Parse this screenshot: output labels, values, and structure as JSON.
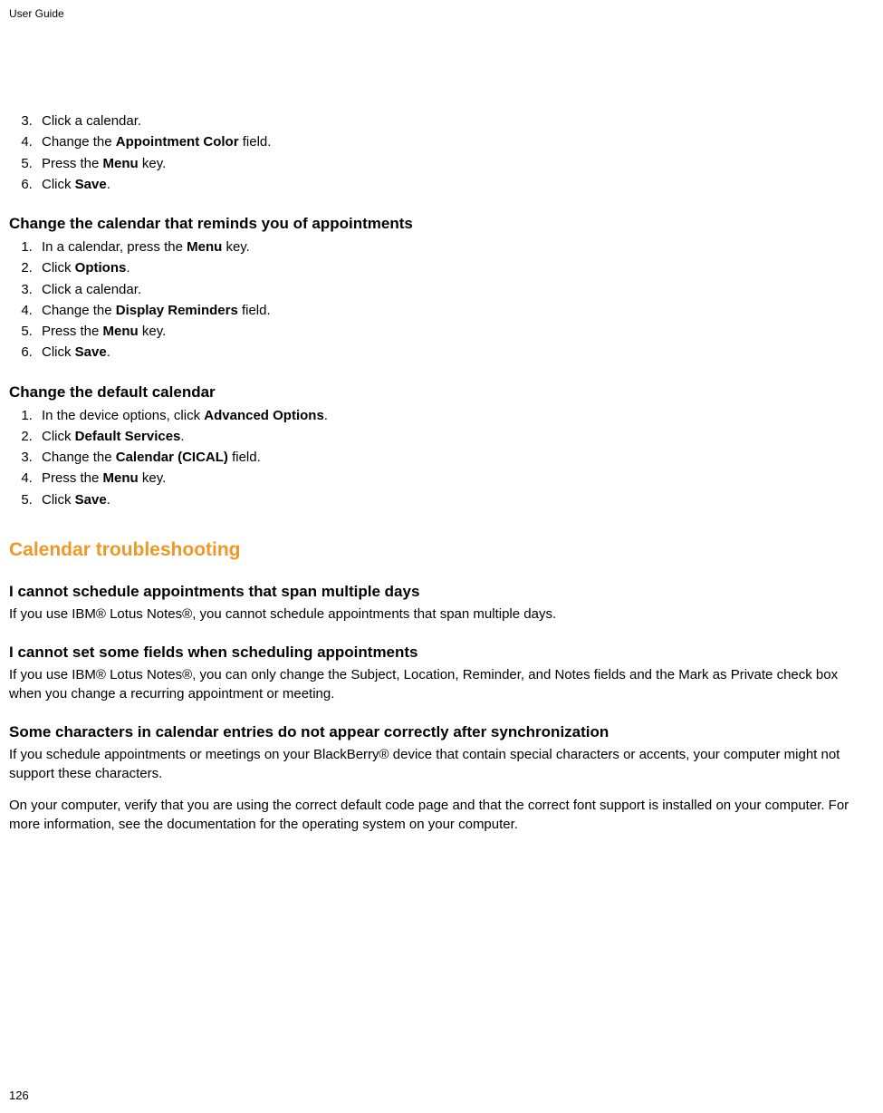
{
  "header": {
    "title": "User Guide"
  },
  "page_number": "126",
  "sectionA": {
    "start": 3,
    "items": [
      [
        {
          "t": "Click a calendar."
        }
      ],
      [
        {
          "t": "Change the "
        },
        {
          "b": "Appointment Color"
        },
        {
          "t": " field."
        }
      ],
      [
        {
          "t": "Press the "
        },
        {
          "b": "Menu"
        },
        {
          "t": " key."
        }
      ],
      [
        {
          "t": "Click "
        },
        {
          "b": "Save"
        },
        {
          "t": "."
        }
      ]
    ]
  },
  "sectionB": {
    "heading": "Change the calendar that reminds you of appointments",
    "start": 1,
    "items": [
      [
        {
          "t": "In a calendar, press the "
        },
        {
          "b": "Menu"
        },
        {
          "t": " key."
        }
      ],
      [
        {
          "t": "Click "
        },
        {
          "b": "Options"
        },
        {
          "t": "."
        }
      ],
      [
        {
          "t": "Click a calendar."
        }
      ],
      [
        {
          "t": "Change the "
        },
        {
          "b": "Display Reminders"
        },
        {
          "t": " field."
        }
      ],
      [
        {
          "t": "Press the "
        },
        {
          "b": "Menu"
        },
        {
          "t": " key."
        }
      ],
      [
        {
          "t": "Click "
        },
        {
          "b": "Save"
        },
        {
          "t": "."
        }
      ]
    ]
  },
  "sectionC": {
    "heading": "Change the default calendar",
    "start": 1,
    "items": [
      [
        {
          "t": "In the device options, click "
        },
        {
          "b": "Advanced Options"
        },
        {
          "t": "."
        }
      ],
      [
        {
          "t": "Click "
        },
        {
          "b": "Default Services"
        },
        {
          "t": "."
        }
      ],
      [
        {
          "t": "Change the "
        },
        {
          "b": "Calendar (CICAL)"
        },
        {
          "t": " field."
        }
      ],
      [
        {
          "t": "Press the "
        },
        {
          "b": "Menu"
        },
        {
          "t": " key."
        }
      ],
      [
        {
          "t": "Click "
        },
        {
          "b": "Save"
        },
        {
          "t": "."
        }
      ]
    ]
  },
  "troubleshooting": {
    "heading": "Calendar troubleshooting",
    "sub1": {
      "heading": "I cannot schedule appointments that span multiple days",
      "para1": "If you use IBM® Lotus Notes®, you cannot schedule appointments that span multiple days."
    },
    "sub2": {
      "heading": "I cannot set some fields when scheduling appointments",
      "para1": "If you use IBM® Lotus Notes®, you can only change the Subject, Location, Reminder, and Notes fields and the Mark as Private check box when you change a recurring appointment or meeting."
    },
    "sub3": {
      "heading": "Some characters in calendar entries do not appear correctly after synchronization",
      "para1": "If you schedule appointments or meetings on your BlackBerry® device that contain special characters or accents, your computer might not support these characters.",
      "para2": "On your computer, verify that you are using the correct default code page and that the correct font support is installed on your computer. For more information, see the documentation for the operating system on your computer."
    }
  }
}
